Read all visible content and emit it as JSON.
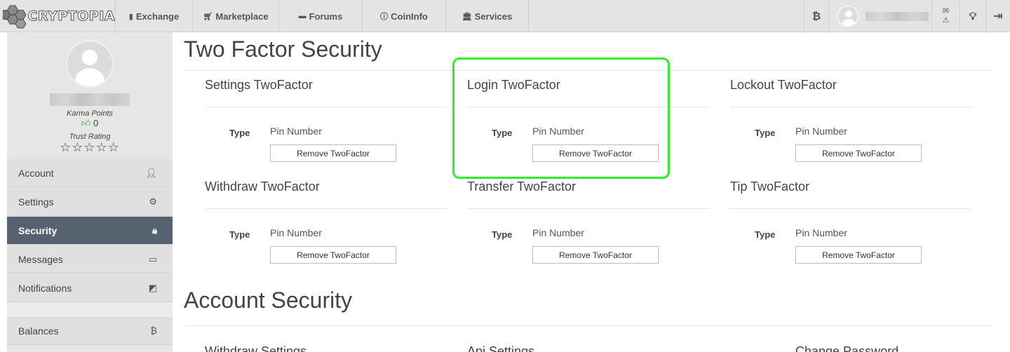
{
  "nav": {
    "brand": "CRYPTOPIA",
    "items": [
      {
        "label": "Exchange",
        "icon": "bar-chart-icon"
      },
      {
        "label": "Marketplace",
        "icon": "cart-icon"
      },
      {
        "label": "Forums",
        "icon": "comments-icon"
      },
      {
        "label": "CoinInfo",
        "icon": "info-icon"
      },
      {
        "label": "Services",
        "icon": "institution-icon"
      }
    ],
    "right_icons": [
      "bitcoin-icon",
      "user-avatar",
      "mail-alert-icon",
      "lightbulb-icon",
      "logout-icon"
    ]
  },
  "profile": {
    "karma_label": "Karma Points",
    "karma_value": "0",
    "trust_label": "Trust Rating",
    "stars": "☆☆☆☆☆"
  },
  "sidebar": {
    "items": [
      {
        "label": "Account",
        "icon": "user-icon",
        "active": false
      },
      {
        "label": "Settings",
        "icon": "gear-icon",
        "active": false
      },
      {
        "label": "Security",
        "icon": "lock-icon",
        "active": true
      },
      {
        "label": "Messages",
        "icon": "inbox-icon",
        "active": false
      },
      {
        "label": "Notifications",
        "icon": "notification-icon",
        "active": false
      },
      {
        "label": "Balances",
        "icon": "bitcoin-icon",
        "active": false
      }
    ]
  },
  "two_factor": {
    "title": "Two Factor Security",
    "cards": [
      {
        "title": "Settings TwoFactor",
        "type_label": "Type",
        "type_value": "Pin Number",
        "button": "Remove TwoFactor"
      },
      {
        "title": "Login TwoFactor",
        "type_label": "Type",
        "type_value": "Pin Number",
        "button": "Remove TwoFactor"
      },
      {
        "title": "Lockout TwoFactor",
        "type_label": "Type",
        "type_value": "Pin Number",
        "button": "Remove TwoFactor"
      },
      {
        "title": "Withdraw TwoFactor",
        "type_label": "Type",
        "type_value": "Pin Number",
        "button": "Remove TwoFactor"
      },
      {
        "title": "Transfer TwoFactor",
        "type_label": "Type",
        "type_value": "Pin Number",
        "button": "Remove TwoFactor"
      },
      {
        "title": "Tip TwoFactor",
        "type_label": "Type",
        "type_value": "Pin Number",
        "button": "Remove TwoFactor"
      }
    ]
  },
  "account_security": {
    "title": "Account Security",
    "sections": [
      "Withdraw Settings",
      "Api Settings",
      "Change Password"
    ]
  },
  "colors": {
    "active_sidebar": "#566270",
    "highlight": "#2df02d",
    "nav_bg": "#e4e4e4"
  }
}
